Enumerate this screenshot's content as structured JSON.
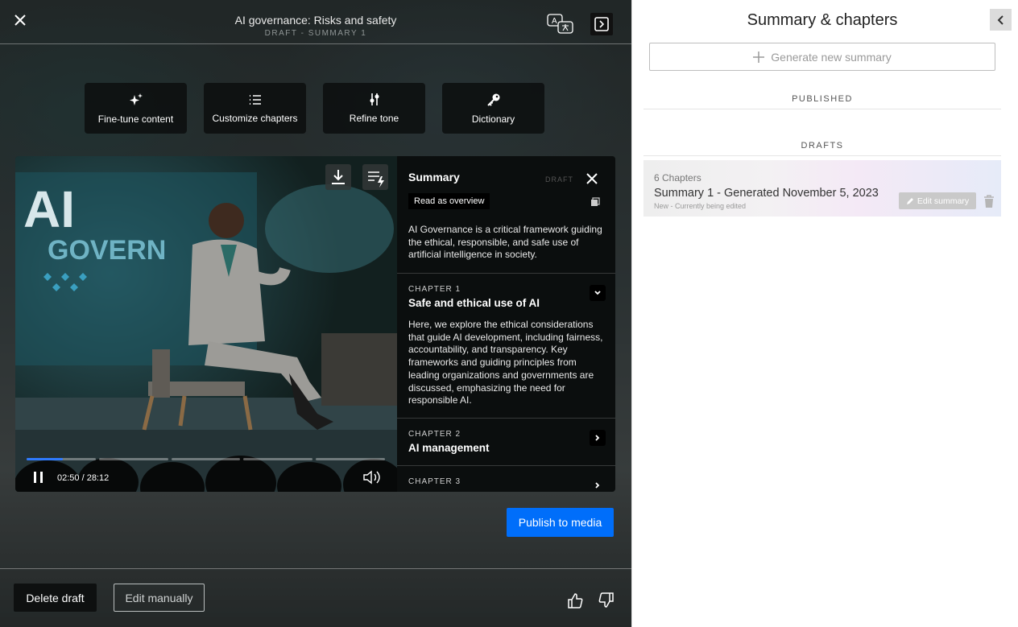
{
  "editor": {
    "title": "AI governance: Risks and safety",
    "subtitle": "DRAFT - SUMMARY 1",
    "icons": {
      "close": "close-icon",
      "translate": "translate-icon",
      "panel": "panel-toggle-icon"
    }
  },
  "tools": [
    {
      "label": "Fine-tune content",
      "icon": "sparkle-icon"
    },
    {
      "label": "Customize chapters",
      "icon": "list-icon"
    },
    {
      "label": "Refine tone",
      "icon": "sliders-icon"
    },
    {
      "label": "Dictionary",
      "icon": "key-icon"
    }
  ],
  "player": {
    "time": "02:50 / 28:12",
    "progress_fraction": 0.1,
    "icons": {
      "download": "download-icon",
      "playlist": "playlist-icon",
      "pause": "pause-icon",
      "volume": "volume-icon"
    }
  },
  "summary_panel": {
    "heading": "Summary",
    "draft_label": "DRAFT",
    "overview_button": "Read as overview",
    "text": "AI Governance is a critical framework guiding the ethical, responsible, and safe use of artificial intelligence in society.",
    "chapters": [
      {
        "number": "CHAPTER 1",
        "title": "Safe and ethical use of AI",
        "body": "Here, we explore the ethical considerations that guide AI development, including fairness, accountability, and transparency. Key frameworks and guiding principles from leading organizations and governments are discussed, emphasizing the need for responsible AI.",
        "expanded": true
      },
      {
        "number": "CHAPTER 2",
        "title": "AI management",
        "expanded": false
      },
      {
        "number": "CHAPTER 3",
        "title": "",
        "expanded": false
      }
    ]
  },
  "actions": {
    "publish": "Publish to media",
    "delete": "Delete draft",
    "edit": "Edit manually"
  },
  "right_panel": {
    "title": "Summary & chapters",
    "generate_button": "Generate new summary",
    "published_label": "PUBLISHED",
    "drafts_label": "DRAFTS",
    "draft": {
      "chapters": "6 Chapters",
      "title": "Summary 1 - Generated November 5, 2023",
      "status": "New - Currently being edited",
      "edit_button": "Edit summary"
    }
  },
  "colors": {
    "accent": "#006efa",
    "progress": "#2f7bff"
  }
}
